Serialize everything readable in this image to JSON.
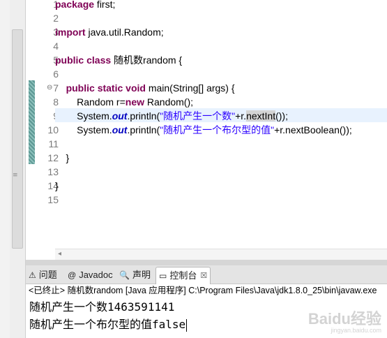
{
  "editor": {
    "line_numbers": [
      "1",
      "2",
      "3",
      "4",
      "5",
      "6",
      "7",
      "8",
      "9",
      "10",
      "11",
      "12",
      "13",
      "14",
      "15"
    ],
    "lines": [
      {
        "n": 1,
        "segments": [
          {
            "t": "package",
            "c": "kw"
          },
          {
            "t": " first;"
          }
        ]
      },
      {
        "n": 3,
        "segments": [
          {
            "t": "import",
            "c": "kw"
          },
          {
            "t": " java.util.Random;"
          }
        ]
      },
      {
        "n": 5,
        "segments": [
          {
            "t": "public",
            "c": "kw"
          },
          {
            "t": " "
          },
          {
            "t": "class",
            "c": "kw"
          },
          {
            "t": " 随机数random {"
          }
        ]
      },
      {
        "n": 7,
        "segments": [
          {
            "t": "    "
          },
          {
            "t": "public",
            "c": "kw"
          },
          {
            "t": " "
          },
          {
            "t": "static",
            "c": "kw"
          },
          {
            "t": " "
          },
          {
            "t": "void",
            "c": "kw"
          },
          {
            "t": " main(String[] args) {"
          }
        ]
      },
      {
        "n": 8,
        "segments": [
          {
            "t": "        Random r="
          },
          {
            "t": "new",
            "c": "kw"
          },
          {
            "t": " Random();"
          }
        ]
      },
      {
        "n": 9,
        "segments": [
          {
            "t": "        System."
          },
          {
            "t": "out",
            "c": "it"
          },
          {
            "t": ".println("
          },
          {
            "t": "\"随机产生一个数\"",
            "c": "str"
          },
          {
            "t": "+r."
          },
          {
            "t": "nextInt",
            "c": "mark"
          },
          {
            "t": "());"
          }
        ]
      },
      {
        "n": 10,
        "segments": [
          {
            "t": "        System."
          },
          {
            "t": "out",
            "c": "it"
          },
          {
            "t": ".println("
          },
          {
            "t": "\"随机产生一个布尔型的值\"",
            "c": "str"
          },
          {
            "t": "+r.nextBoolean());"
          }
        ]
      },
      {
        "n": 12,
        "segments": [
          {
            "t": "    }"
          }
        ]
      },
      {
        "n": 14,
        "segments": [
          {
            "t": "}"
          }
        ]
      }
    ]
  },
  "console_tabs": [
    {
      "icon": "problems-icon",
      "glyph": "⚠",
      "label": "问题"
    },
    {
      "icon": "javadoc-icon",
      "glyph": "@",
      "label": "Javadoc"
    },
    {
      "icon": "declaration-icon",
      "glyph": "🔍",
      "label": "声明"
    },
    {
      "icon": "console-icon",
      "glyph": "▭",
      "label": "控制台",
      "active": true,
      "close": "☒"
    }
  ],
  "console": {
    "header": "<已终止> 随机数random [Java 应用程序] C:\\Program Files\\Java\\jdk1.8.0_25\\bin\\javaw.exe",
    "output_lines": [
      {
        "prefix": "随机产生一个数",
        "value": "1463591141"
      },
      {
        "prefix": "随机产生一个布尔型的值",
        "value": "false"
      }
    ]
  },
  "watermark": {
    "main": "Baidu经验",
    "sub": "jingyan.baidu.com"
  }
}
